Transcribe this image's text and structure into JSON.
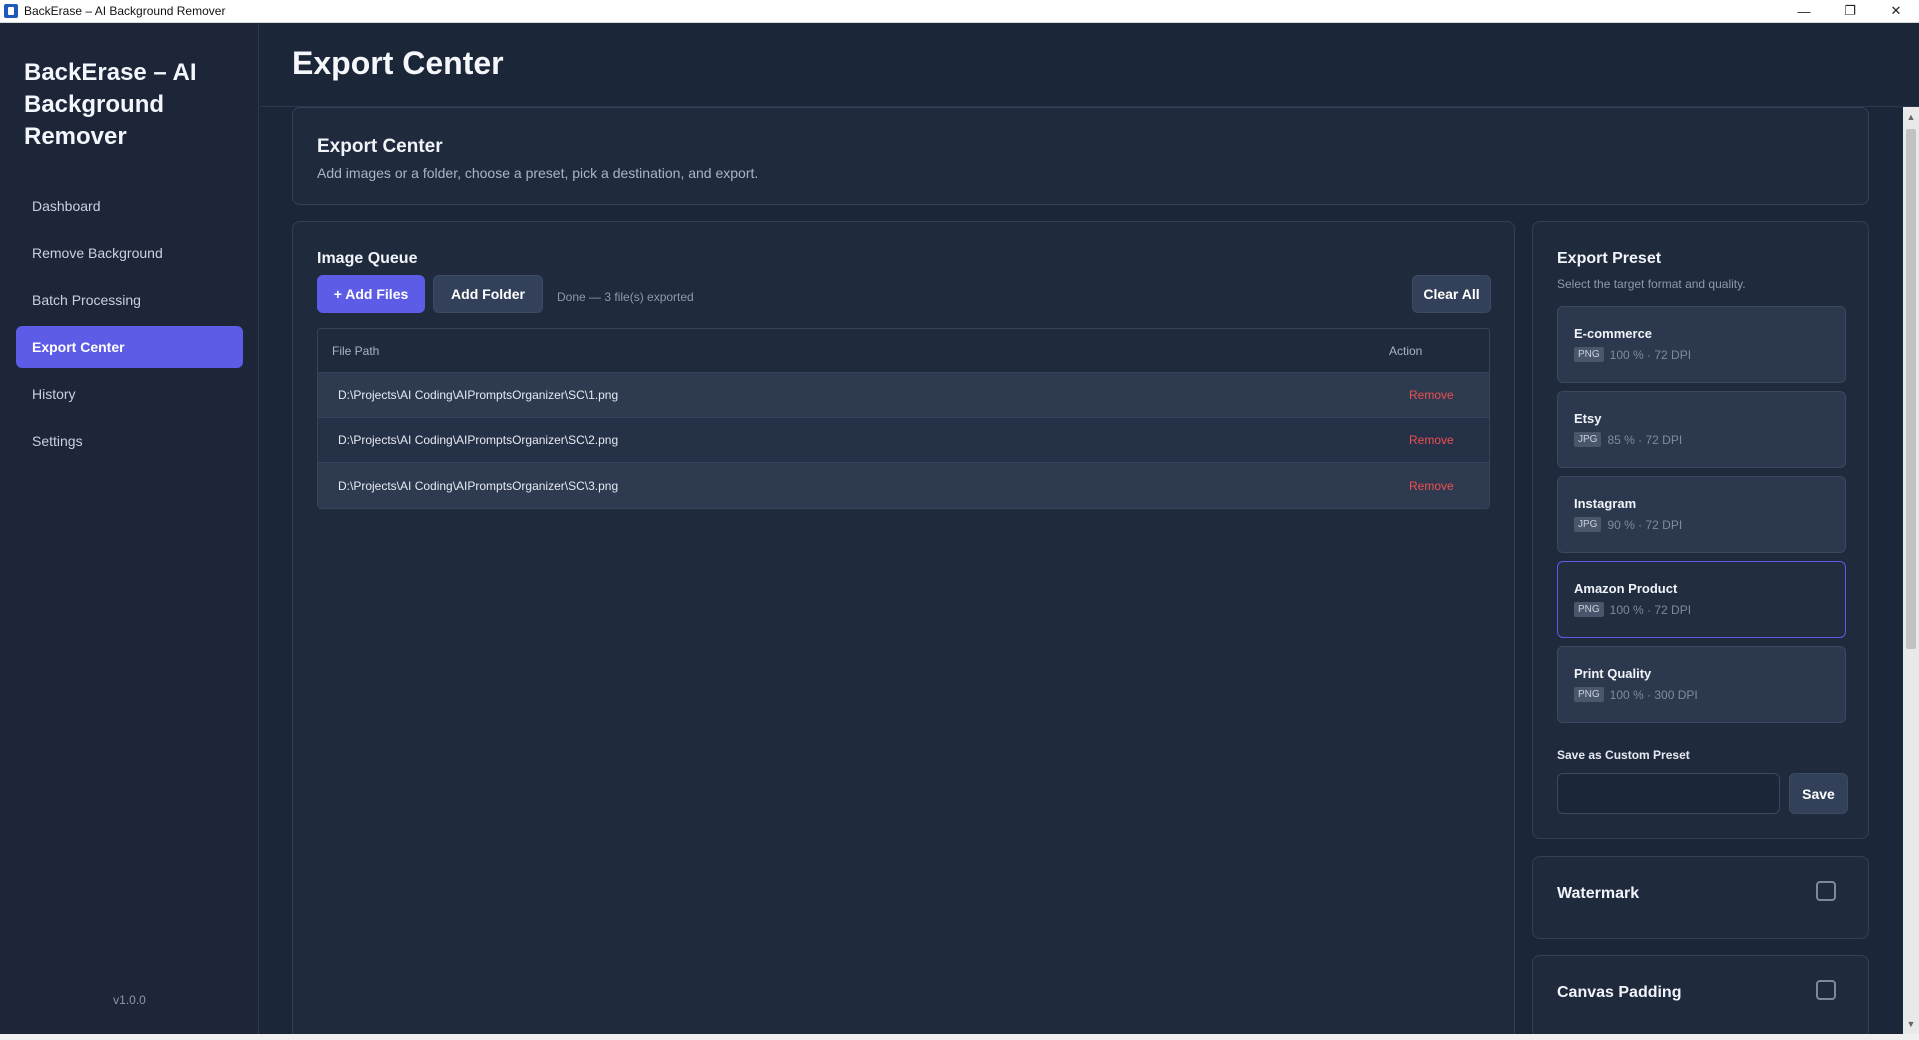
{
  "window": {
    "title": "BackErase – AI Background Remover",
    "controls": [
      "—",
      "❐",
      "✕"
    ]
  },
  "sidebar": {
    "brand": "BackErase – AI Background Remover",
    "items": [
      {
        "label": "Dashboard",
        "active": false
      },
      {
        "label": "Remove Background",
        "active": false
      },
      {
        "label": "Batch Processing",
        "active": false
      },
      {
        "label": "Export Center",
        "active": true
      },
      {
        "label": "History",
        "active": false
      },
      {
        "label": "Settings",
        "active": false
      }
    ],
    "version": "v1.0.0"
  },
  "header": {
    "title": "Export Center"
  },
  "hero": {
    "title": "Export Center",
    "subtitle": "Add images or a folder, choose a preset, pick a destination, and export."
  },
  "queue": {
    "title": "Image Queue",
    "add_files_label": "+ Add Files",
    "add_folder_label": "Add Folder",
    "status": "Done — 3 file(s) exported",
    "clear_all_label": "Clear All",
    "columns": {
      "path": "File Path",
      "action": "Action"
    },
    "rows": [
      {
        "path": "D:\\Projects\\AI Coding\\AIPromptsOrganizer\\SC\\1.png",
        "action": "Remove"
      },
      {
        "path": "D:\\Projects\\AI Coding\\AIPromptsOrganizer\\SC\\2.png",
        "action": "Remove"
      },
      {
        "path": "D:\\Projects\\AI Coding\\AIPromptsOrganizer\\SC\\3.png",
        "action": "Remove"
      }
    ]
  },
  "preset": {
    "title": "Export Preset",
    "subtitle": "Select the target format and quality.",
    "items": [
      {
        "name": "E-commerce",
        "format": "PNG",
        "details": "100 % · 72 DPI",
        "selected": false
      },
      {
        "name": "Etsy",
        "format": "JPG",
        "details": "85 % · 72 DPI",
        "selected": false
      },
      {
        "name": "Instagram",
        "format": "JPG",
        "details": "90 % · 72 DPI",
        "selected": false
      },
      {
        "name": "Amazon Product",
        "format": "PNG",
        "details": "100 % · 72 DPI",
        "selected": true
      },
      {
        "name": "Print Quality",
        "format": "PNG",
        "details": "100 % · 300 DPI",
        "selected": false
      }
    ],
    "custom_label": "Save as Custom Preset",
    "custom_value": "",
    "save_label": "Save"
  },
  "options": {
    "watermark_label": "Watermark",
    "watermark_checked": false,
    "padding_label": "Canvas Padding",
    "padding_checked": false
  },
  "colors": {
    "accent": "#5d5ce6",
    "danger": "#ef4f4f",
    "background": "#1b2638",
    "card": "#1f2a3d"
  }
}
